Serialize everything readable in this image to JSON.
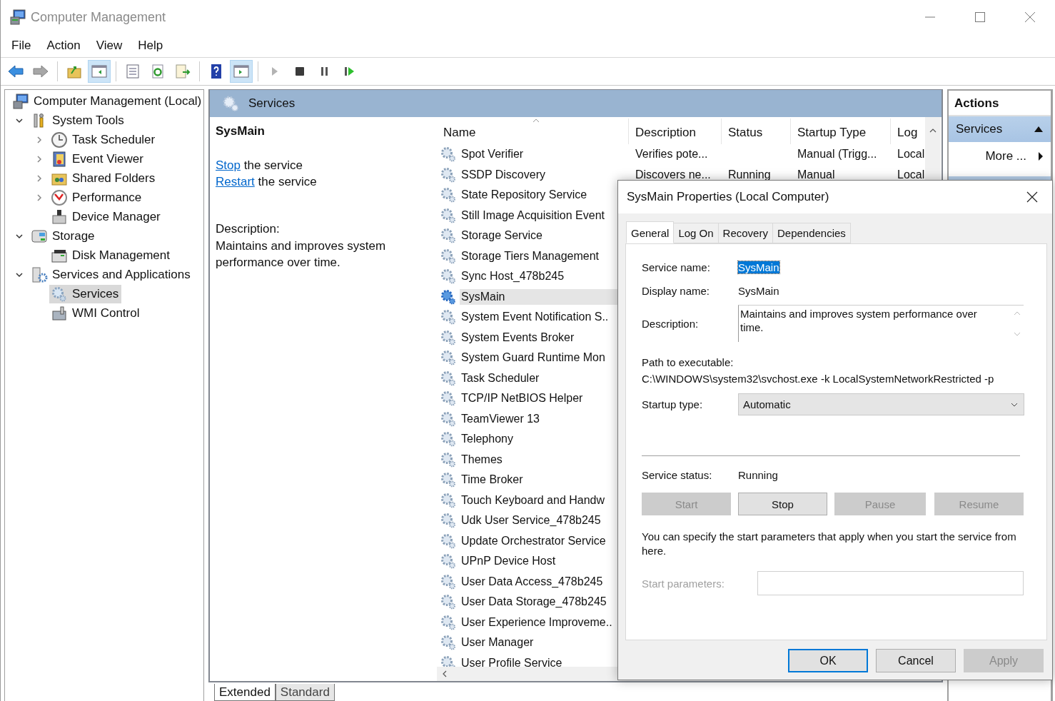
{
  "window": {
    "title": "Computer Management"
  },
  "menu": [
    "File",
    "Action",
    "View",
    "Help"
  ],
  "toolbar": [
    {
      "kind": "back",
      "on": false,
      "disabled": false
    },
    {
      "kind": "forward",
      "on": false,
      "disabled": true
    },
    {
      "kind": "separator"
    },
    {
      "kind": "up-folder",
      "on": false,
      "disabled": false
    },
    {
      "kind": "tree-pane",
      "on": true,
      "disabled": false
    },
    {
      "kind": "separator"
    },
    {
      "kind": "properties",
      "on": false,
      "disabled": false
    },
    {
      "kind": "refresh",
      "on": false,
      "disabled": false
    },
    {
      "kind": "export",
      "on": false,
      "disabled": false
    },
    {
      "kind": "separator"
    },
    {
      "kind": "help",
      "on": false,
      "disabled": false
    },
    {
      "kind": "action-pane",
      "on": true,
      "disabled": false
    },
    {
      "kind": "separator"
    },
    {
      "kind": "play",
      "on": false,
      "disabled": true
    },
    {
      "kind": "stop",
      "on": false,
      "disabled": false
    },
    {
      "kind": "pause",
      "on": false,
      "disabled": false
    },
    {
      "kind": "resume",
      "on": false,
      "disabled": false
    }
  ],
  "tree": [
    {
      "label": "Computer Management (Local)",
      "kind": "computer",
      "selected": false,
      "children": [
        {
          "label": "System Tools",
          "kind": "tools",
          "selected": false,
          "expanded": true,
          "children": [
            {
              "label": "Task Scheduler",
              "kind": "clock",
              "selected": false,
              "expanded": false
            },
            {
              "label": "Event Viewer",
              "kind": "viewer",
              "selected": false,
              "expanded": false
            },
            {
              "label": "Shared Folders",
              "kind": "folder",
              "selected": false,
              "expanded": false
            },
            {
              "label": "Performance",
              "kind": "performance",
              "selected": false,
              "expanded": false
            },
            {
              "label": "Device Manager",
              "kind": "device",
              "selected": false
            }
          ]
        },
        {
          "label": "Storage",
          "kind": "storage",
          "selected": false,
          "expanded": true,
          "children": [
            {
              "label": "Disk Management",
              "kind": "disk",
              "selected": false
            }
          ]
        },
        {
          "label": "Services and Applications",
          "kind": "apps",
          "selected": false,
          "expanded": true,
          "children": [
            {
              "label": "Services",
              "kind": "services",
              "selected": true
            },
            {
              "label": "WMI Control",
              "kind": "wmi",
              "selected": false
            }
          ]
        }
      ]
    }
  ],
  "pane": {
    "title": "Services"
  },
  "detail": {
    "title": "SysMain",
    "actions": [
      {
        "link": "Stop",
        "text": "the service"
      },
      {
        "link": "Restart",
        "text": "the service"
      }
    ],
    "description_label": "Description:",
    "description": "Maintains and improves system performance over time."
  },
  "list": {
    "columns": [
      {
        "label": "Name",
        "sorted": true
      },
      {
        "label": "Description",
        "sorted": false
      },
      {
        "label": "Status",
        "sorted": false
      },
      {
        "label": "Startup Type",
        "sorted": false
      },
      {
        "label": "Log",
        "sorted": false
      }
    ],
    "rows": [
      {
        "name": "Spot Verifier",
        "selected": false,
        "description": "Verifies pote...",
        "startup_type": "Manual (Trigg...",
        "log_on": "Local"
      },
      {
        "name": "SSDP Discovery",
        "selected": false,
        "description": "Discovers ne...",
        "status": "Running",
        "startup_type": "Manual",
        "log_on": "Local"
      },
      {
        "name": "State Repository Service",
        "selected": false
      },
      {
        "name": "Still Image Acquisition Event",
        "selected": false
      },
      {
        "name": "Storage Service",
        "selected": false
      },
      {
        "name": "Storage Tiers Management",
        "selected": false
      },
      {
        "name": "Sync Host_478b245",
        "selected": false
      },
      {
        "name": "SysMain",
        "selected": true
      },
      {
        "name": "System Event Notification S..",
        "selected": false
      },
      {
        "name": "System Events Broker",
        "selected": false
      },
      {
        "name": "System Guard Runtime Mon",
        "selected": false
      },
      {
        "name": "Task Scheduler",
        "selected": false
      },
      {
        "name": "TCP/IP NetBIOS Helper",
        "selected": false
      },
      {
        "name": "TeamViewer 13",
        "selected": false
      },
      {
        "name": "Telephony",
        "selected": false
      },
      {
        "name": "Themes",
        "selected": false
      },
      {
        "name": "Time Broker",
        "selected": false
      },
      {
        "name": "Touch Keyboard and Handw",
        "selected": false
      },
      {
        "name": "Udk User Service_478b245",
        "selected": false
      },
      {
        "name": "Update Orchestrator Service",
        "selected": false
      },
      {
        "name": "UPnP Device Host",
        "selected": false
      },
      {
        "name": "User Data Access_478b245",
        "selected": false
      },
      {
        "name": "User Data Storage_478b245",
        "selected": false
      },
      {
        "name": "User Experience Improveme..",
        "selected": false
      },
      {
        "name": "User Manager",
        "selected": false
      },
      {
        "name": "User Profile Service",
        "selected": false
      }
    ]
  },
  "view_tabs": [
    {
      "label": "Extended",
      "selected": true
    },
    {
      "label": "Standard",
      "selected": false
    }
  ],
  "actions": {
    "title": "Actions",
    "sections": [
      {
        "label": "Services",
        "expanded": true,
        "items": [
          "More ..."
        ]
      }
    ]
  },
  "dialog": {
    "title": "SysMain Properties (Local Computer)",
    "tabs": [
      {
        "label": "General",
        "selected": true
      },
      {
        "label": "Log On",
        "selected": false
      },
      {
        "label": "Recovery",
        "selected": false
      },
      {
        "label": "Dependencies",
        "selected": false
      }
    ],
    "service_name": {
      "label": "Service name:",
      "value": "SysMain",
      "value_selected": true
    },
    "display_name": {
      "label": "Display name:",
      "value": "SysMain"
    },
    "description": {
      "label": "Description:",
      "value": "Maintains and improves system performance over time."
    },
    "path": {
      "label": "Path to executable:",
      "value": "C:\\WINDOWS\\system32\\svchost.exe -k LocalSystemNetworkRestricted -p"
    },
    "startup_type": {
      "label": "Startup type:",
      "value": "Automatic"
    },
    "service_status": {
      "label": "Service status:",
      "value": "Running"
    },
    "control_buttons": [
      {
        "label": "Start",
        "disabled": true
      },
      {
        "label": "Stop",
        "disabled": false
      },
      {
        "label": "Pause",
        "disabled": true
      },
      {
        "label": "Resume",
        "disabled": true
      }
    ],
    "hint": "You can specify the start parameters that apply when you start the service from here.",
    "start_parameters": {
      "label": "Start parameters:",
      "disabled": true
    },
    "buttons": [
      {
        "label": "OK",
        "default": true,
        "disabled": false
      },
      {
        "label": "Cancel",
        "default": false,
        "disabled": false
      },
      {
        "label": "Apply",
        "default": false,
        "disabled": true
      }
    ]
  }
}
